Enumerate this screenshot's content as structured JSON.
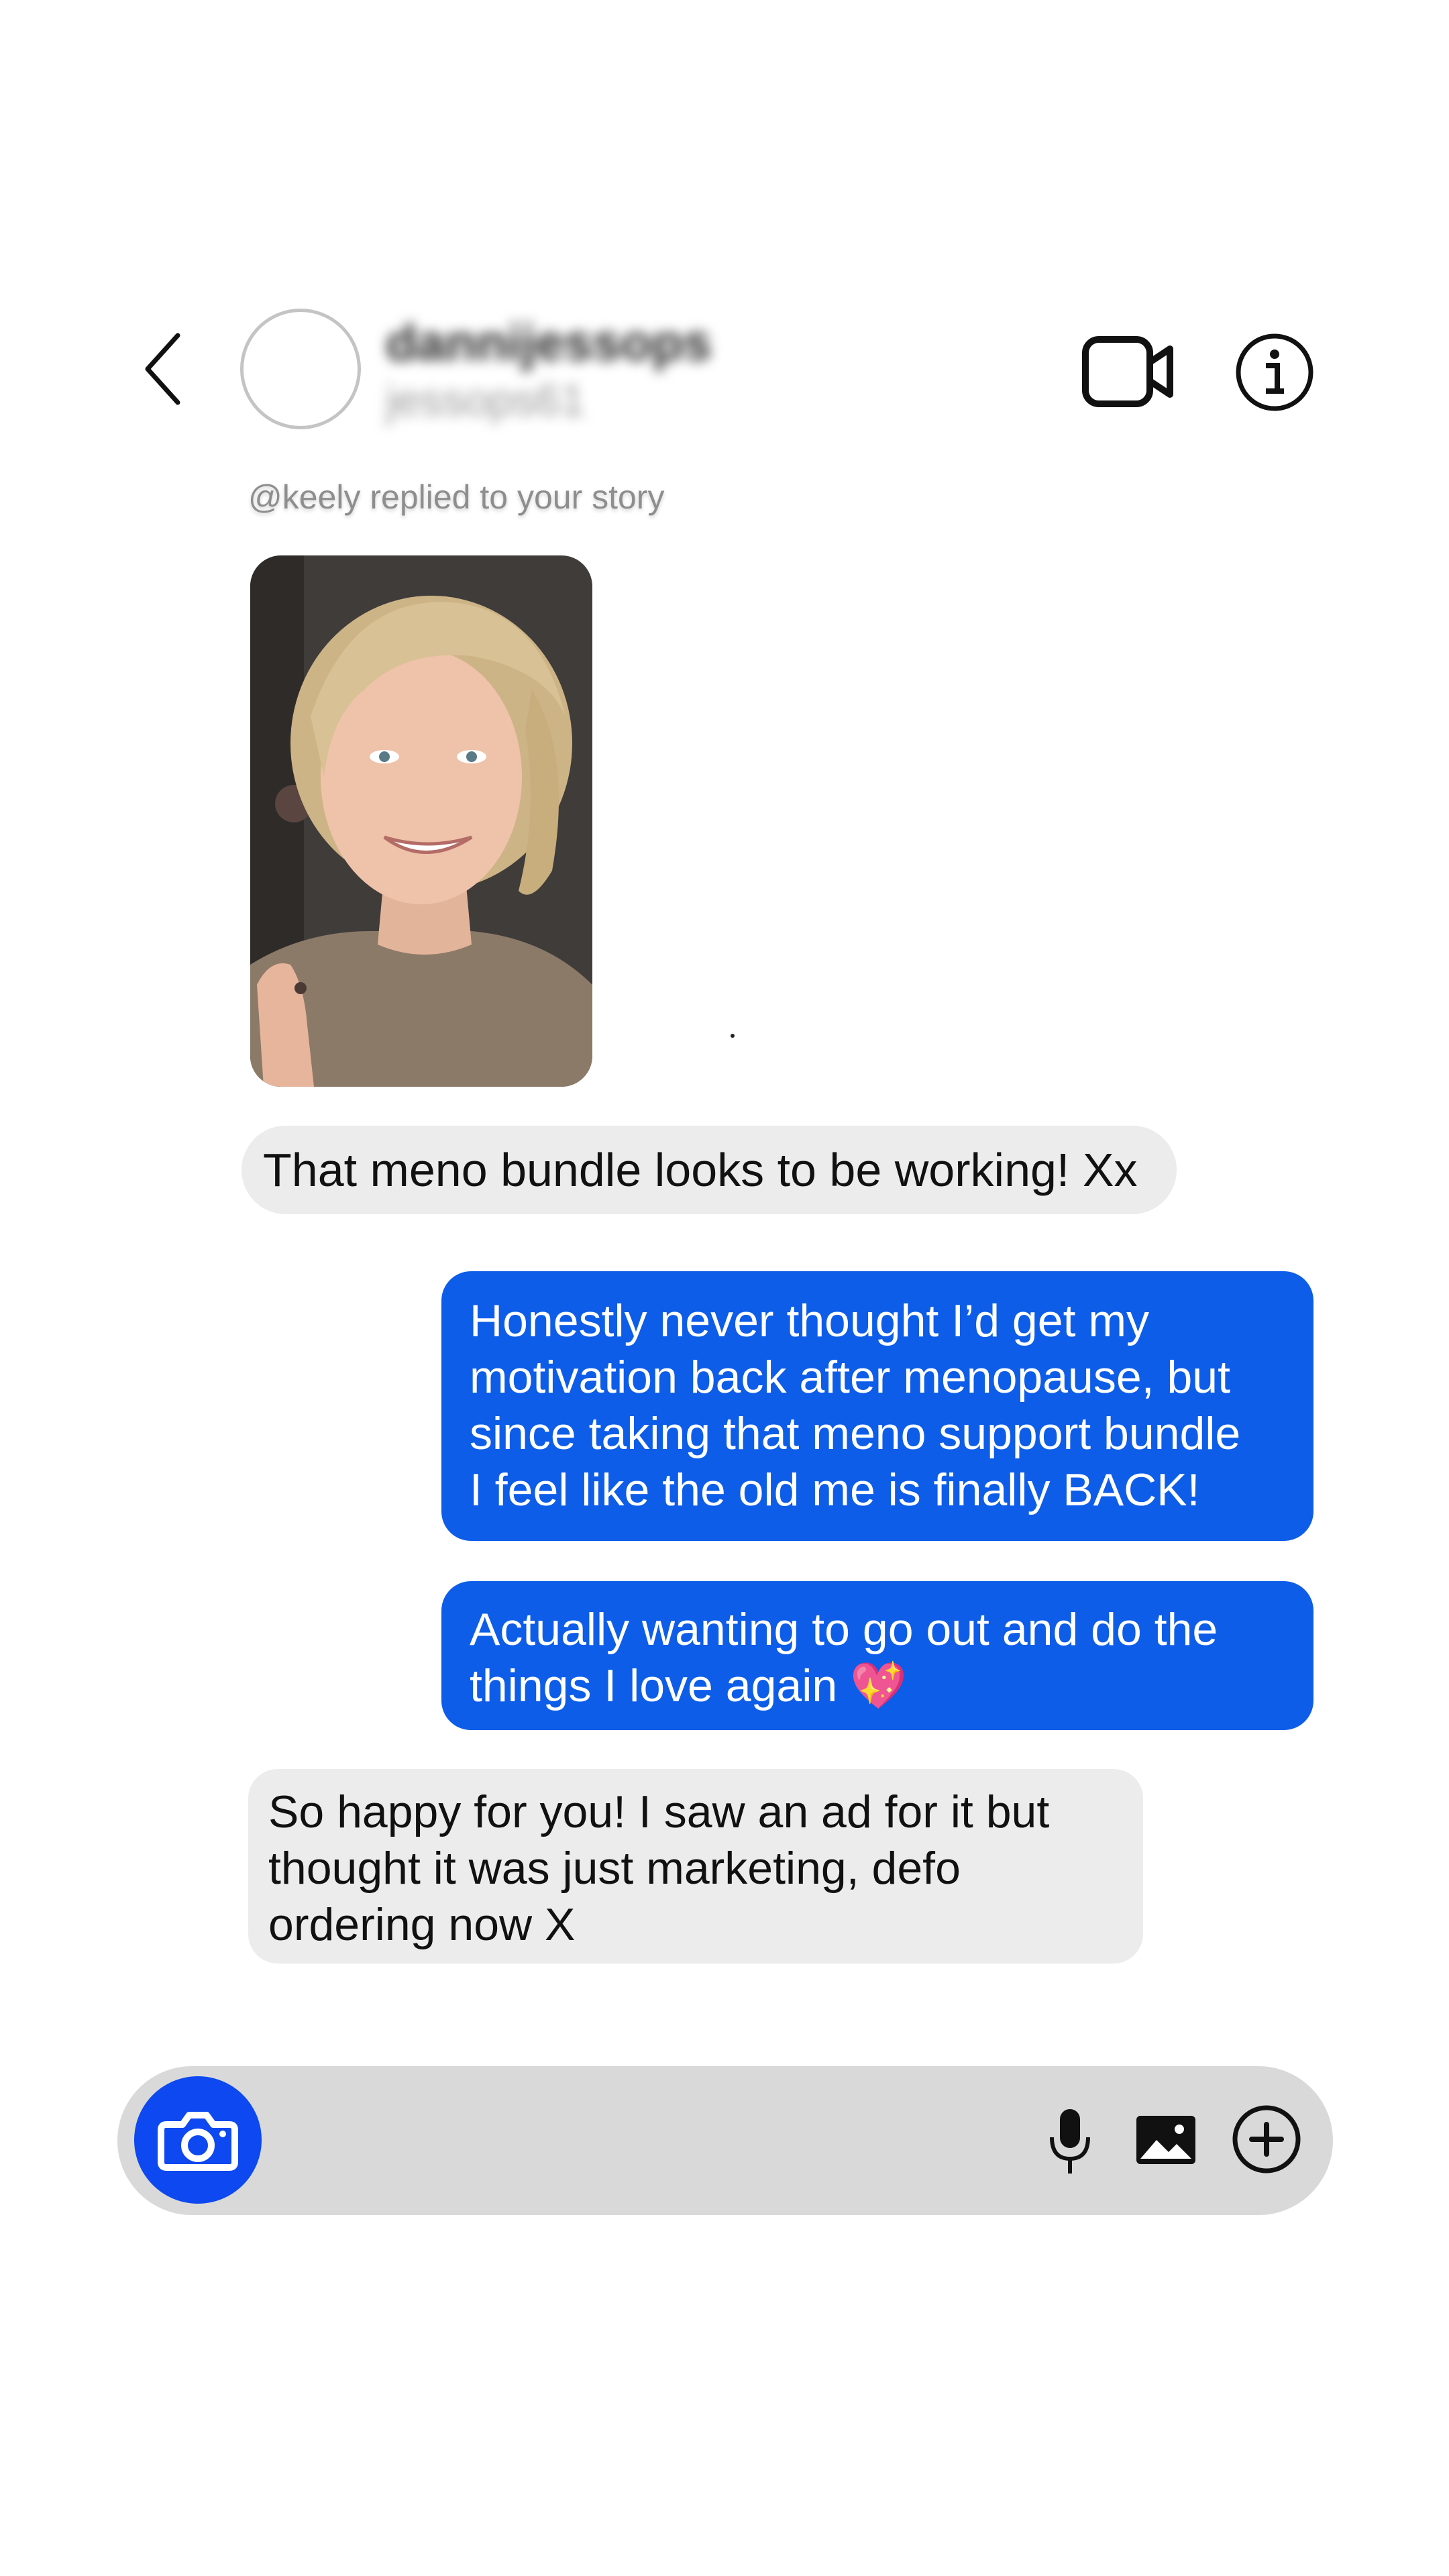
{
  "header": {
    "username": "dannijessops",
    "handle": "jessops61",
    "back_icon": "chevron-left-icon",
    "video_icon": "video-camera-icon",
    "info_icon": "info-icon"
  },
  "story_reply_note": "@keely replied to your story",
  "story_image": {
    "description_icon": "story-photo"
  },
  "messages": [
    {
      "direction": "incoming",
      "lines": [
        "That meno bundle looks to be working! Xx"
      ]
    },
    {
      "direction": "outgoing",
      "lines": [
        "Honestly never thought I’d get my",
        "motivation back after menopause, but",
        "since taking that meno support bundle",
        "I feel like the old me is finally BACK!"
      ]
    },
    {
      "direction": "outgoing",
      "lines": [
        "Actually wanting to go out and do the",
        "things I love again 💖"
      ]
    },
    {
      "direction": "incoming",
      "lines": [
        "So happy for you! I saw an ad for it but",
        "thought it was just marketing, defo",
        "ordering now X"
      ]
    }
  ],
  "composer": {
    "camera_icon": "camera-icon",
    "mic_icon": "microphone-icon",
    "gallery_icon": "image-icon",
    "add_icon": "plus-circle-icon"
  },
  "colors": {
    "outgoing_bubble": "#0d5de8",
    "incoming_bubble": "#ececec",
    "camera_button": "#0d48f0",
    "composer_bg": "#d9d9d9"
  }
}
